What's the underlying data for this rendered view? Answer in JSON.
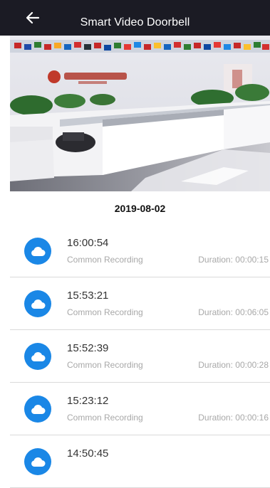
{
  "header": {
    "title": "Smart Video Doorbell",
    "back_icon": "arrow-left-icon"
  },
  "date": "2019-08-02",
  "recordings": [
    {
      "time": "16:00:54",
      "type": "Common Recording",
      "duration": "Duration: 00:00:15"
    },
    {
      "time": "15:53:21",
      "type": "Common Recording",
      "duration": "Duration: 00:06:05"
    },
    {
      "time": "15:52:39",
      "type": "Common Recording",
      "duration": "Duration: 00:00:28"
    },
    {
      "time": "15:23:12",
      "type": "Common Recording",
      "duration": "Duration: 00:00:16"
    },
    {
      "time": "14:50:45",
      "type": "",
      "duration": ""
    }
  ],
  "colors": {
    "header_bg": "#1b1b24",
    "accent": "#1a87e6"
  }
}
